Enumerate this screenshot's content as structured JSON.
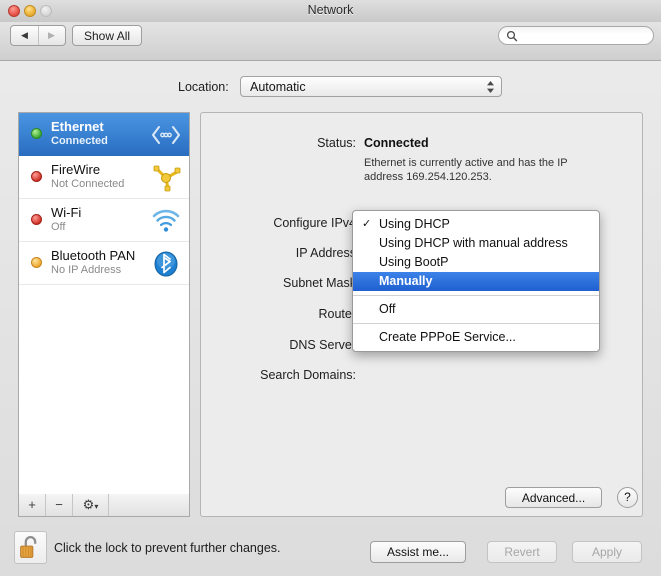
{
  "window": {
    "title": "Network",
    "traffic_lights": [
      "close",
      "minimize",
      "zoom"
    ]
  },
  "toolbar": {
    "back_icon": "◀",
    "forward_icon": "▶",
    "show_all_label": "Show All",
    "search_placeholder": "",
    "search_value": ""
  },
  "location": {
    "label": "Location:",
    "value": "Automatic"
  },
  "sidebar": {
    "items": [
      {
        "name": "Ethernet",
        "status": "Connected",
        "dot": "green",
        "icon": "ethernet-icon",
        "selected": true
      },
      {
        "name": "FireWire",
        "status": "Not Connected",
        "dot": "red",
        "icon": "firewire-icon",
        "selected": false
      },
      {
        "name": "Wi-Fi",
        "status": "Off",
        "dot": "red",
        "icon": "wifi-icon",
        "selected": false
      },
      {
        "name": "Bluetooth PAN",
        "status": "No IP Address",
        "dot": "orange",
        "icon": "bluetooth-icon",
        "selected": false
      }
    ],
    "add_label": "+",
    "remove_label": "−",
    "action_label": "⚙"
  },
  "main": {
    "status_label": "Status:",
    "status_value": "Connected",
    "status_description": "Ethernet is currently active and has the IP address 169.254.120.253.",
    "configure_label": "Configure IPv4",
    "ip_address_label": "IP Address",
    "subnet_mask_label": "Subnet Mask",
    "router_label": "Router",
    "dns_server_label": "DNS Server",
    "search_domains_label": "Search Domains:",
    "configure_value": "Using DHCP",
    "advanced_label": "Advanced...",
    "help_label": "?"
  },
  "menu": {
    "checkmark": "✓",
    "items": [
      {
        "label": "Using DHCP",
        "checked": true,
        "highlighted": false,
        "separator_before": false
      },
      {
        "label": "Using DHCP with manual address",
        "checked": false,
        "highlighted": false,
        "separator_before": false
      },
      {
        "label": "Using BootP",
        "checked": false,
        "highlighted": false,
        "separator_before": false
      },
      {
        "label": "Manually",
        "checked": false,
        "highlighted": true,
        "separator_before": false
      },
      {
        "label": "Off",
        "checked": false,
        "highlighted": false,
        "separator_before": true
      },
      {
        "label": "Create PPPoE Service...",
        "checked": false,
        "highlighted": false,
        "separator_before": true
      }
    ]
  },
  "footer": {
    "lock_icon": "unlocked-padlock-icon",
    "lock_text": "Click the lock to prevent further changes.",
    "assist_label": "Assist me...",
    "revert_label": "Revert",
    "apply_label": "Apply"
  },
  "colors": {
    "selection_blue": "#2a6ec2",
    "menu_highlight": "#1f5fd0",
    "window_bg": "#ececec"
  }
}
